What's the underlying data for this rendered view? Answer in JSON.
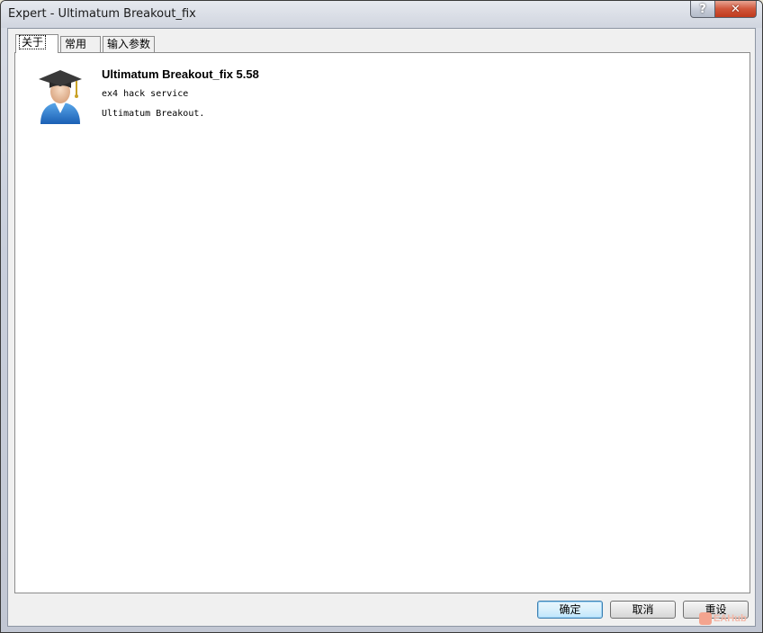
{
  "window": {
    "title": "Expert - Ultimatum Breakout_fix"
  },
  "titlebar": {
    "help_label": "?",
    "close_label": "✕"
  },
  "tabs": [
    {
      "label": "关于",
      "active": true
    },
    {
      "label": "常用",
      "active": false
    },
    {
      "label": "输入参数",
      "active": false
    }
  ],
  "about": {
    "name": "Ultimatum Breakout_fix 5.58",
    "copyright": "ex4 hack service",
    "description": "Ultimatum Breakout.",
    "icon": "expert-graduate-icon"
  },
  "buttons": {
    "ok": "确定",
    "cancel": "取消",
    "reset": "重设"
  },
  "watermark": {
    "text": "EAHub"
  }
}
